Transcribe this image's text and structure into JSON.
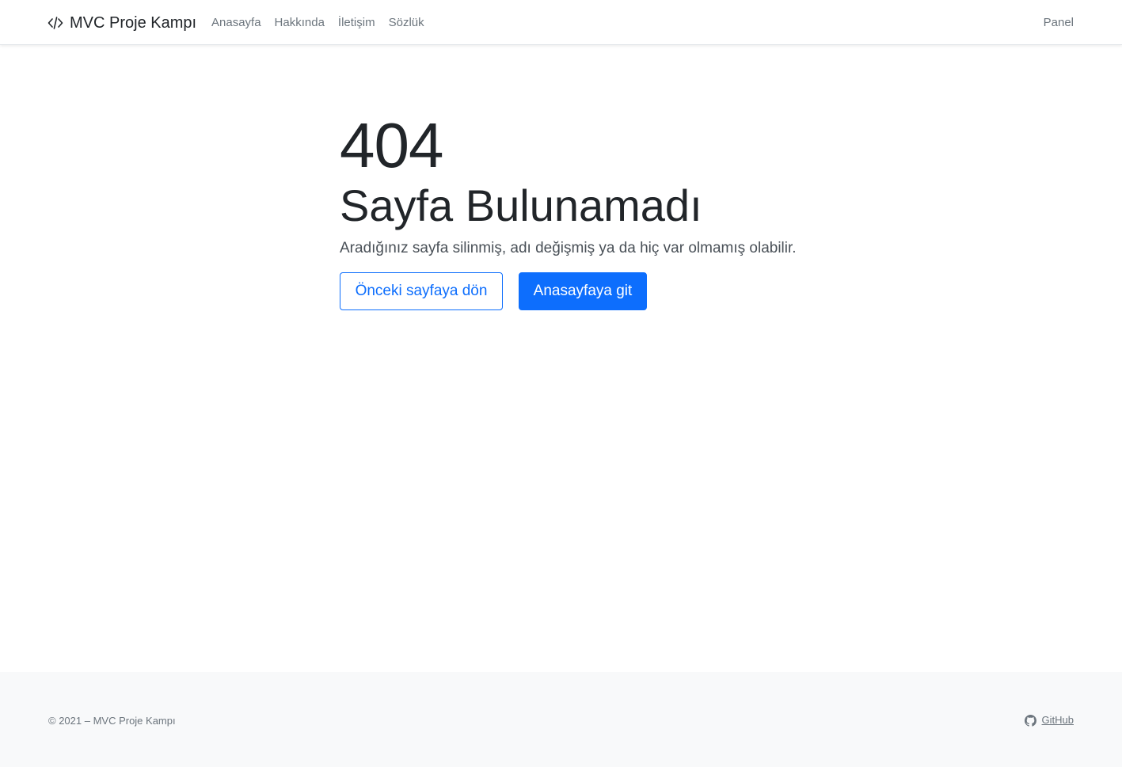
{
  "navbar": {
    "brand_label": "MVC Proje Kampı",
    "brand_icon": "code-icon",
    "links": [
      {
        "label": "Anasayfa"
      },
      {
        "label": "Hakkında"
      },
      {
        "label": "İletişim"
      },
      {
        "label": "Sözlük"
      }
    ],
    "panel_label": "Panel"
  },
  "error": {
    "code": "404",
    "title": "Sayfa Bulunamadı",
    "message": "Aradığınız sayfa silinmiş, adı değişmiş ya da hiç var olmamış olabilir.",
    "back_button_label": "Önceki sayfaya dön",
    "home_button_label": "Anasayfaya git"
  },
  "footer": {
    "copyright": "© 2021 – MVC Proje Kampı",
    "github_label": "GitHub",
    "github_icon": "github-icon"
  },
  "colors": {
    "primary": "#0d6efd",
    "muted": "#6c757d",
    "footer_bg": "#f8f9fa"
  }
}
